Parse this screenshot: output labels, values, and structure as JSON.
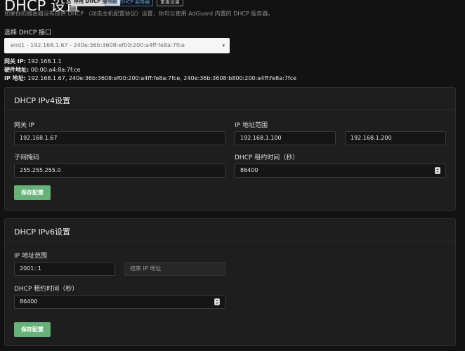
{
  "header": {
    "title": "DHCP 设置",
    "disable_button": "停用 DHCP 服务器",
    "check_button": "检查 DHCP 服务器",
    "reset_button": "重置设置",
    "description": "如果你的路由器没有提供 DHCP （动态主机配置协议）设置，你可以使用 AdGuard 内置的 DHCP 服务器。"
  },
  "interface": {
    "label": "选择 DHCP 接口",
    "selected": "end1 - 192.168.1.67 - 240e:36b:3608:ef00:200:a4ff:fe8a:7fce"
  },
  "info": {
    "gateway_label": "网关 IP:",
    "gateway_value": "192.168.1.1",
    "mac_label": "硬件地址:",
    "mac_value": "00:00:a4:8a:7f:ce",
    "ip_label": "IP 地址:",
    "ip_value": "192.168.1.67, 240e:36b:3608:ef00:200:a4ff:fe8a:7fce, 240e:36b:3608:b800:200:a4ff:fe8a:7fce"
  },
  "ipv4": {
    "title": "DHCP IPv4设置",
    "gateway_label": "网关 IP",
    "gateway_value": "192.168.1.67",
    "range_label": "IP 地址范围",
    "range_start": "192.168.1.100",
    "range_end": "192.168.1.200",
    "mask_label": "子网掩码",
    "mask_value": "255.255.255.0",
    "lease_label": "DHCP 租约时间（秒）",
    "lease_value": "86400",
    "save_label": "保存配置"
  },
  "ipv6": {
    "title": "DHCP IPv6设置",
    "range_label": "IP 地址范围",
    "range_start": "2001::1",
    "range_end_placeholder": "结束 IP 地址",
    "lease_label": "DHCP 租约时间（秒）",
    "lease_value": "86400",
    "save_label": "保存配置"
  },
  "colors": {
    "background": "#121212",
    "card": "#1e1e1e",
    "accent_green": "#67b279",
    "link_blue": "#5d93d1"
  },
  "icons": {
    "select_caret": "chevron-down-icon",
    "number_spinner": "spinner-arrows-icon"
  }
}
